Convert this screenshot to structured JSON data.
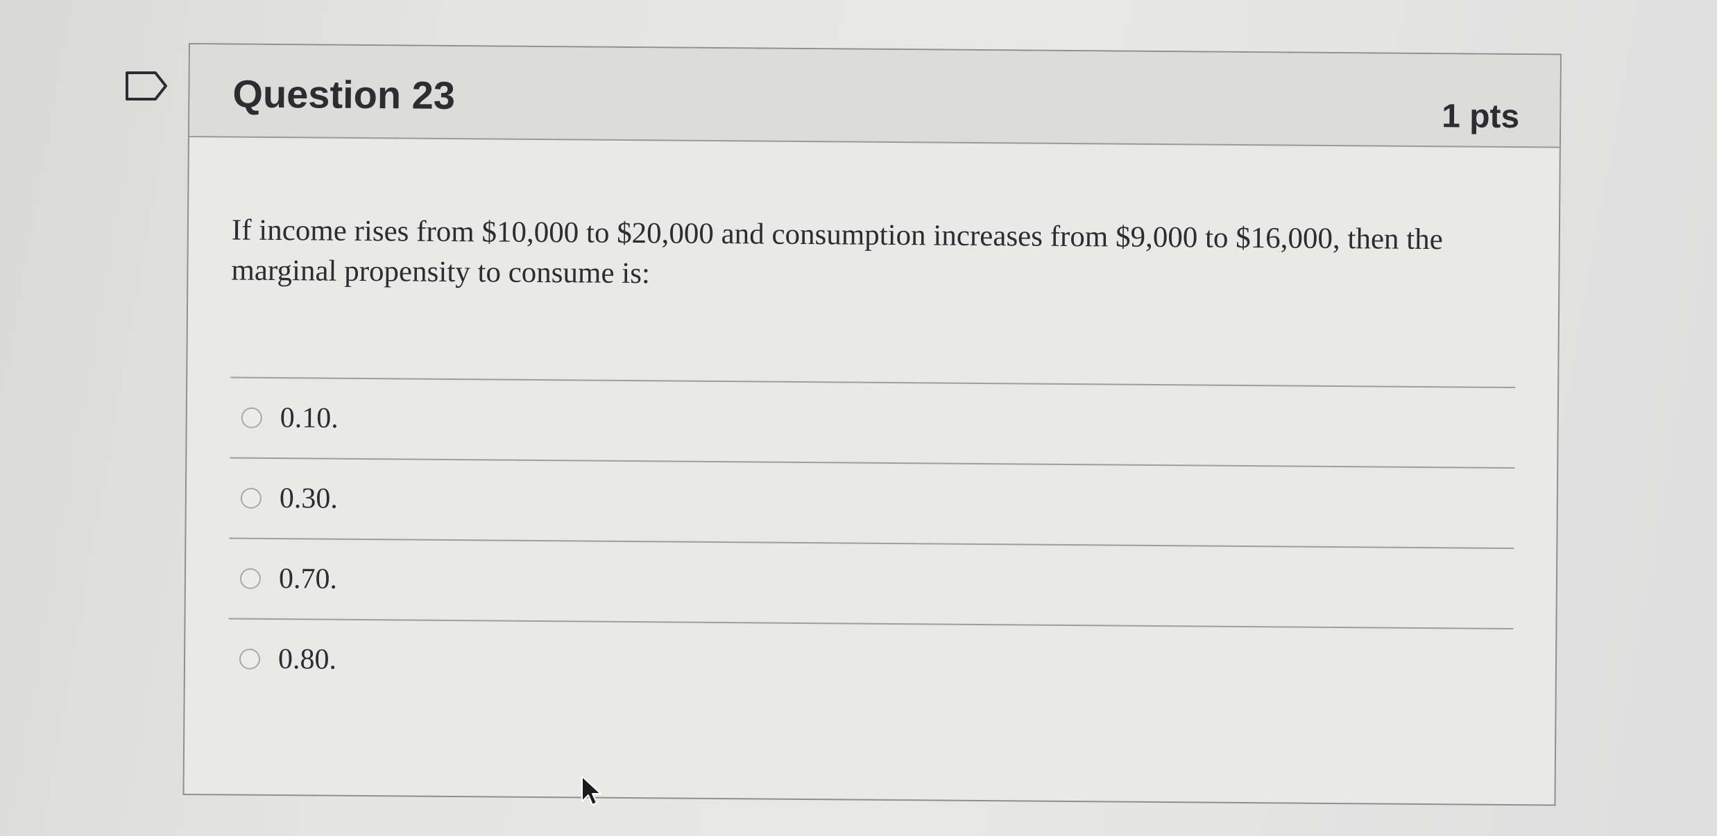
{
  "question": {
    "title": "Question 23",
    "points": "1 pts",
    "text": "If income rises from $10,000 to $20,000 and consumption increases from $9,000 to $16,000, then the marginal propensity to consume is:",
    "answers": [
      {
        "label": "0.10."
      },
      {
        "label": "0.30."
      },
      {
        "label": "0.70."
      },
      {
        "label": "0.80."
      }
    ]
  },
  "icons": {
    "flag": "flag-question-icon",
    "cursor": "mouse-pointer-icon"
  },
  "colors": {
    "text": "#2c2d30",
    "header_bg": "#dcdcda",
    "card_bg": "#e9e9e7",
    "border": "#8f8f8d"
  }
}
